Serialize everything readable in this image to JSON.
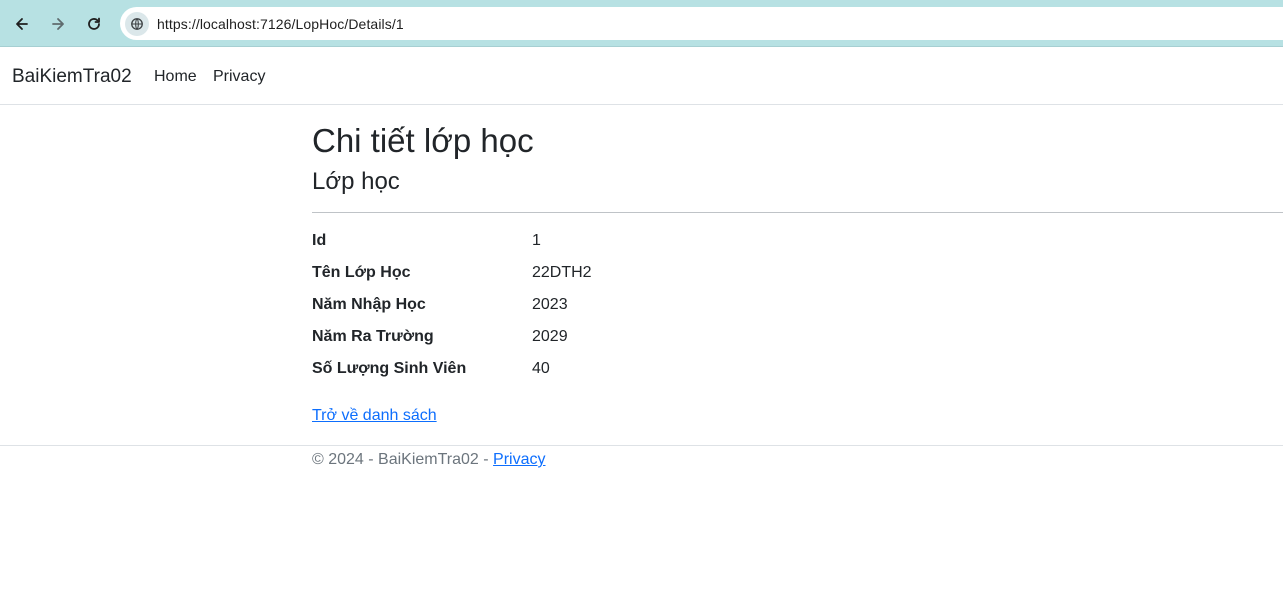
{
  "browser": {
    "url": "https://localhost:7126/LopHoc/Details/1"
  },
  "navbar": {
    "brand": "BaiKiemTra02",
    "links": [
      "Home",
      "Privacy"
    ]
  },
  "main": {
    "title": "Chi tiết lớp học",
    "subtitle": "Lớp học",
    "details": [
      {
        "label": "Id",
        "value": "1"
      },
      {
        "label": "Tên Lớp Học",
        "value": "22DTH2"
      },
      {
        "label": "Năm Nhập Học",
        "value": "2023"
      },
      {
        "label": "Năm Ra Trường",
        "value": "2029"
      },
      {
        "label": "Số Lượng Sinh Viên",
        "value": "40"
      }
    ],
    "back_link": "Trở về danh sách"
  },
  "footer": {
    "text": "© 2024 - BaiKiemTra02 - ",
    "privacy_link": "Privacy"
  },
  "colors": {
    "browser_bar": "#b7e1e3",
    "link": "#0d6efd",
    "text": "#212529",
    "muted": "#6c757d"
  }
}
